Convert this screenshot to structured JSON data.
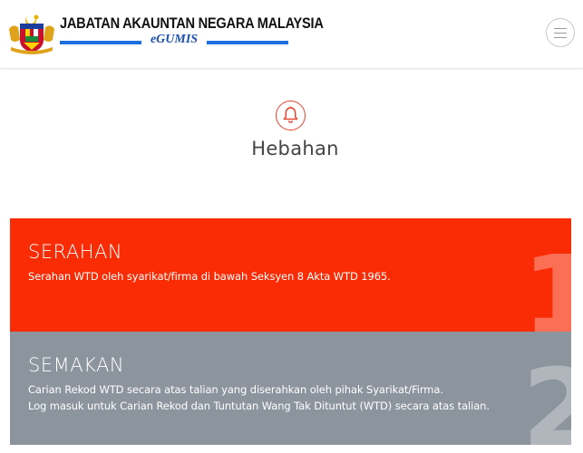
{
  "header": {
    "org_name": "JABATAN AKAUNTAN NEGARA MALAYSIA",
    "brand": "eGUMIS",
    "menu_icon": "hamburger-menu-icon",
    "crest_icon": "coat-of-arms-icon"
  },
  "section": {
    "icon": "bell-icon",
    "title": "Hebahan"
  },
  "panels": [
    {
      "title": "SERAHAN",
      "lines": [
        "Serahan WTD oleh syarikat/firma di bawah Seksyen 8 Akta WTD 1965."
      ],
      "number": "1",
      "color": "#fa2c06"
    },
    {
      "title": "SEMAKAN",
      "lines": [
        "Carian Rekod WTD secara atas talian yang diserahkan oleh pihak Syarikat/Firma.",
        "Log masuk untuk Carian Rekod dan Tuntutan Wang Tak Dituntut (WTD) secara atas talian."
      ],
      "number": "2",
      "color": "#8c949d"
    }
  ],
  "colors": {
    "accent": "#e8402a",
    "brand_blue": "#1d6fe0"
  }
}
